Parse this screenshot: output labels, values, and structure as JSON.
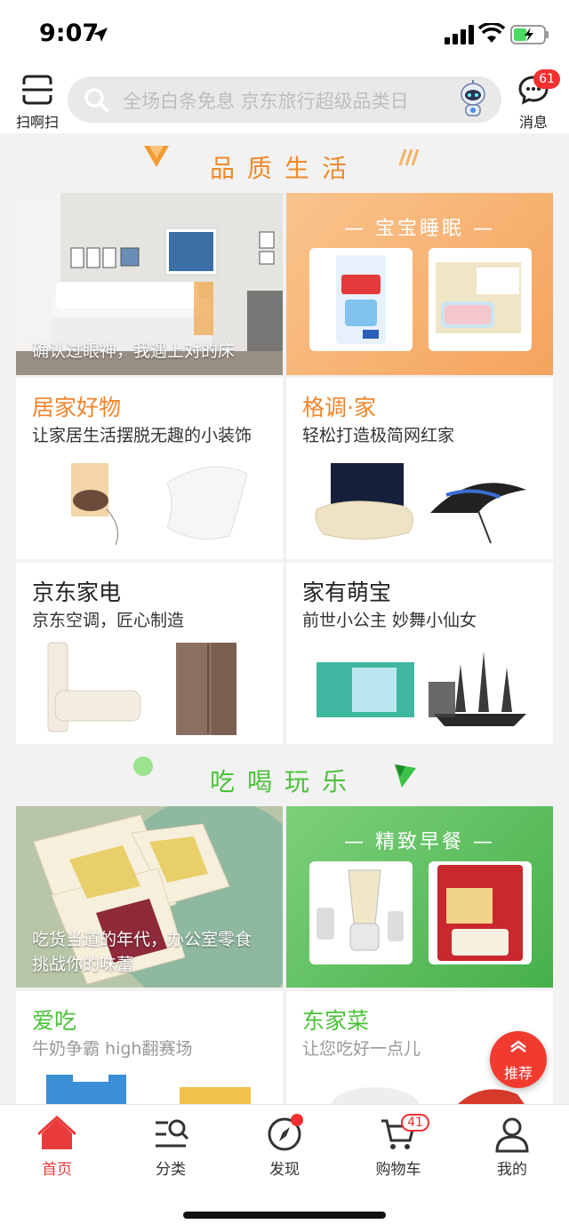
{
  "status_bar": {
    "time": "9:07"
  },
  "header": {
    "scan_label": "扫啊扫",
    "search_placeholder": "全场白条免息 京东旅行超级品类日",
    "messages_label": "消息",
    "messages_badge": "61"
  },
  "sections": {
    "quality_life": {
      "title": "品质生活",
      "hero_caption": "确认过眼神，我遇上对的床",
      "banner_title": "— 宝宝睡眠 —",
      "cards": [
        {
          "title": "居家好物",
          "subtitle": "让家居生活摆脱无趣的小装饰"
        },
        {
          "title": "格调·家",
          "subtitle": "轻松打造极简网红家"
        },
        {
          "title": "京东家电",
          "subtitle": "京东空调，匠心制造"
        },
        {
          "title": "家有萌宝",
          "subtitle": "前世小公主 妙舞小仙女"
        }
      ]
    },
    "eat_drink": {
      "title": "吃喝玩乐",
      "hero_caption_line1": "吃货当道的年代，办公室零食",
      "hero_caption_line2": "挑战你的味蕾",
      "banner_title": "— 精致早餐 —",
      "cards": [
        {
          "title": "爱吃",
          "subtitle": "牛奶争霸 high翻赛场"
        },
        {
          "title": "东家菜",
          "subtitle": "让您吃好一点儿"
        }
      ]
    }
  },
  "fab": {
    "label": "推荐"
  },
  "tabbar": {
    "items": [
      {
        "label": "首页",
        "active": true
      },
      {
        "label": "分类"
      },
      {
        "label": "发现"
      },
      {
        "label": "购物车",
        "badge": "41"
      },
      {
        "label": "我的"
      }
    ]
  },
  "colors": {
    "accent_red": "#e93b3b",
    "quality_orange": "#f0852c",
    "eat_green": "#4cc23a"
  }
}
